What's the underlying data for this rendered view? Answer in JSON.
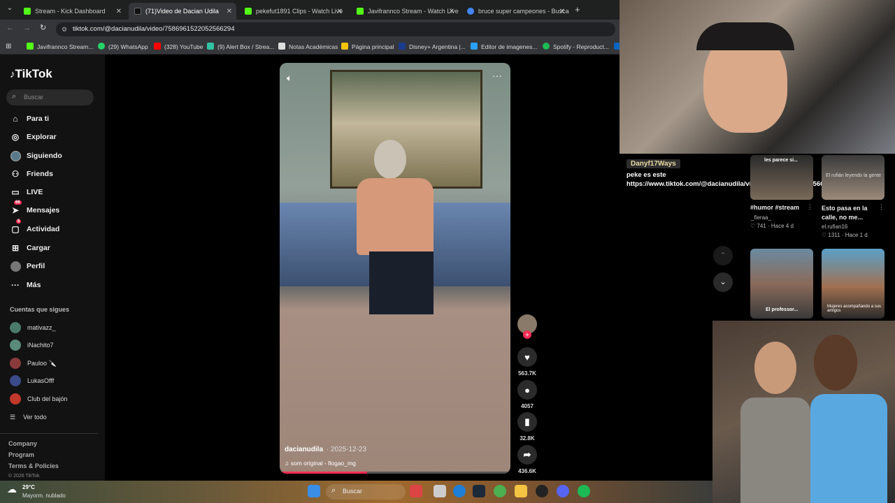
{
  "browser": {
    "tabs": [
      {
        "title": "Stream - Kick Dashboard",
        "color": "#53fc18"
      },
      {
        "title": "(71)Video de Dacian Udila",
        "color": "#111111"
      },
      {
        "title": "pekefut1891 Clips - Watch Live",
        "color": "#53fc18"
      },
      {
        "title": "Javifrannco Stream - Watch Live",
        "color": "#53fc18"
      },
      {
        "title": "bruce super campeones - Busca",
        "color": "#4285f4"
      }
    ],
    "url": "tiktok.com/@dacianudila/video/7586961522052566294",
    "bookmarks": [
      {
        "label": "Javifrannco Stream...",
        "color": "#53fc18"
      },
      {
        "label": "(29) WhatsApp",
        "color": "#25d366"
      },
      {
        "label": "(328) YouTube",
        "color": "#ff0000"
      },
      {
        "label": "(9) Alert Box / Strea...",
        "color": "#31c3a2"
      },
      {
        "label": "Notas Académicas",
        "color": "#dddddd"
      },
      {
        "label": "Página principal",
        "color": "#f4c20d"
      },
      {
        "label": "Disney+ Argentina |...",
        "color": "#1a3c8f"
      },
      {
        "label": "Editor de imagenes...",
        "color": "#2aa1ff"
      },
      {
        "label": "Spotify - Reproduct...",
        "color": "#1db954"
      }
    ]
  },
  "tiktok": {
    "logo": "TikTok",
    "search_placeholder": "Buscar",
    "nav": [
      {
        "label": "Para ti",
        "icon": "home-icon",
        "glyph": "⌂"
      },
      {
        "label": "Explorar",
        "icon": "compass-icon",
        "glyph": "◎"
      },
      {
        "label": "Siguiendo",
        "icon": "following-icon",
        "glyph": "●"
      },
      {
        "label": "Friends",
        "icon": "friends-icon",
        "glyph": "⚇"
      },
      {
        "label": "LIVE",
        "icon": "live-icon",
        "glyph": "▭"
      },
      {
        "label": "Mensajes",
        "icon": "messages-icon",
        "glyph": "➤",
        "badge": "66"
      },
      {
        "label": "Actividad",
        "icon": "activity-icon",
        "glyph": "▢",
        "badge": "5"
      },
      {
        "label": "Cargar",
        "icon": "upload-icon",
        "glyph": "⊞"
      },
      {
        "label": "Perfil",
        "icon": "profile-icon",
        "glyph": "●"
      },
      {
        "label": "Más",
        "icon": "more-icon",
        "glyph": "···"
      }
    ],
    "following_heading": "Cuentas que sigues",
    "following": [
      {
        "name": "mativazz_",
        "color": "#4a7a6a"
      },
      {
        "name": "iNachito7",
        "color": "#5a8a7a"
      },
      {
        "name": "Pauloo 🔪",
        "color": "#8a3a3a"
      },
      {
        "name": "LukasOfff",
        "color": "#3a4a8a"
      },
      {
        "name": "Club del bajón",
        "color": "#c0392b"
      }
    ],
    "see_all": "Ver todo",
    "footer": [
      "Company",
      "Program",
      "Terms & Policies"
    ],
    "copyright": "© 2026 TikTok",
    "video": {
      "author": "dacianudila",
      "date": "· 2025-12-23",
      "sound": "som original - flogao_mg",
      "likes": "563.7K",
      "comments": "4057",
      "saves": "32.8K",
      "shares": "436.6K"
    },
    "recommendations": [
      {
        "caption": "#humor #stream",
        "author": "_fieraa_",
        "likes": "741",
        "age": "Hace 4 d",
        "overlay": "les parece si..."
      },
      {
        "caption": "Esto pasa en la calle, no me...",
        "author": "el.rufian16",
        "likes": "1311",
        "age": "Hace 1 d",
        "overlay": "El rufián leyendo la gente"
      },
      {
        "overlay": "El professor..."
      },
      {
        "overlay": "Mujeres acompañando a sus amigos"
      }
    ]
  },
  "chat": {
    "user": "Danyf17Ways",
    "message": "peke es este",
    "link": "https://www.tiktok.com/@dacianudila/video/7586961522052566294"
  },
  "taskbar": {
    "weather_temp": "29°C",
    "weather_desc": "Mayorm. nublado",
    "search": "Buscar"
  }
}
